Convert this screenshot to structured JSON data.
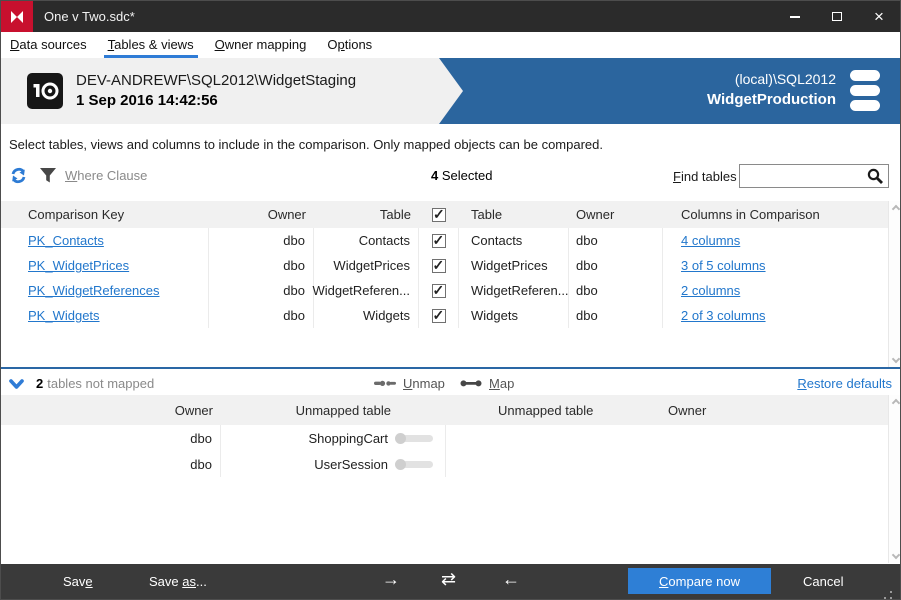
{
  "colors": {
    "brand_red": "#c8102e",
    "accent_blue": "#2f7cd6",
    "banner_blue": "#2b659e",
    "link_blue": "#2277cc",
    "button_blue": "#2e7fd6"
  },
  "window": {
    "title": "One v Two.sdc*"
  },
  "menu": {
    "items": [
      {
        "pre": "",
        "key": "D",
        "post": "ata sources"
      },
      {
        "pre": "",
        "key": "T",
        "post": "ables & views"
      },
      {
        "pre": "",
        "key": "O",
        "post": "wner mapping"
      },
      {
        "pre": "O",
        "key": "p",
        "post": "tions"
      }
    ]
  },
  "banner": {
    "source_server": "DEV-ANDREWF\\SQL2012\\WidgetStaging",
    "source_timestamp": "1 Sep 2016 14:42:56",
    "target_server": "(local)\\SQL2012",
    "target_database": "WidgetProduction"
  },
  "instruction": "Select tables, views and columns to include in the comparison. Only mapped objects can be compared.",
  "toolbar": {
    "where_clause": {
      "pre": "",
      "key": "W",
      "post": "here Clause"
    },
    "selected_count": "4",
    "selected_label": " Selected",
    "find_tables": {
      "pre": "",
      "key": "F",
      "post": "ind tables"
    },
    "search_value": ""
  },
  "comparison_table": {
    "headers": {
      "comparison_key": "Comparison Key",
      "owner_left": "Owner",
      "table_left": "Table",
      "table_right": "Table",
      "owner_right": "Owner",
      "columns": "Columns in Comparison"
    },
    "header_checked": "checked",
    "rows": [
      {
        "key": "PK_Contacts",
        "owner_left": "dbo",
        "table_left": "Contacts",
        "checked": "checked",
        "table_right": "Contacts",
        "owner_right": "dbo",
        "columns": "4 columns"
      },
      {
        "key": "PK_WidgetPrices",
        "owner_left": "dbo",
        "table_left": "WidgetPrices",
        "checked": "checked",
        "table_right": "WidgetPrices",
        "owner_right": "dbo",
        "columns": "3 of 5 columns"
      },
      {
        "key": "PK_WidgetReferences",
        "owner_left": "dbo",
        "table_left": "WidgetReferen...",
        "checked": "checked",
        "table_right": "WidgetReferen...",
        "owner_right": "dbo",
        "columns": "2 columns"
      },
      {
        "key": "PK_Widgets",
        "owner_left": "dbo",
        "table_left": "Widgets",
        "checked": "checked",
        "table_right": "Widgets",
        "owner_right": "dbo",
        "columns": "2 of 3 columns"
      }
    ]
  },
  "unmapped_section": {
    "count": "2",
    "label": "tables not mapped",
    "unmap": {
      "pre": "",
      "key": "U",
      "post": "nmap"
    },
    "map": {
      "pre": "",
      "key": "M",
      "post": "ap"
    },
    "restore_defaults": {
      "pre": "",
      "key": "R",
      "post": "estore defaults"
    }
  },
  "unmapped_table": {
    "headers": {
      "owner_left": "Owner",
      "table_left": "Unmapped table",
      "table_right": "Unmapped table",
      "owner_right": "Owner"
    },
    "rows": [
      {
        "owner": "dbo",
        "table": "ShoppingCart"
      },
      {
        "owner": "dbo",
        "table": "UserSession"
      }
    ]
  },
  "footer": {
    "save": {
      "pre": "Sav",
      "key": "e",
      "post": ""
    },
    "save_as": {
      "pre": "Save ",
      "key": "as",
      "post": "..."
    },
    "arrow_right": "→",
    "arrow_swap": "⇄",
    "arrow_left": "←",
    "compare_now": {
      "pre": "",
      "key": "C",
      "post": "ompare now"
    },
    "cancel": "Cancel"
  }
}
